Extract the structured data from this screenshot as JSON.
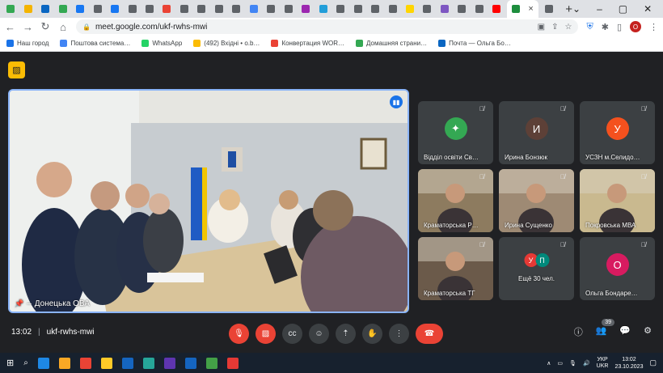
{
  "browser": {
    "tab_close": "×",
    "new_tab": "+",
    "url": "meet.google.com/ukf-rwhs-mwi",
    "profile_initial": "О",
    "bookmarks": [
      {
        "label": "Наш город",
        "color": "#1a73e8"
      },
      {
        "label": "Поштова система…",
        "color": "#4285f4"
      },
      {
        "label": "WhatsApp",
        "color": "#25d366"
      },
      {
        "label": "(492) Вхідні • o.b…",
        "color": "#fbbc04"
      },
      {
        "label": "Конвертация WOR…",
        "color": "#ea4335"
      },
      {
        "label": "Домашняя страни…",
        "color": "#34a853"
      },
      {
        "label": "Почта — Ольга Бо…",
        "color": "#0a66c2"
      }
    ],
    "tab_colors": [
      "#34a853",
      "#f4b400",
      "#0a66c2",
      "#34a853",
      "#1877f2",
      "#5f6368",
      "#1877f2",
      "#5f6368",
      "#5f6368",
      "#ea4335",
      "#5f6368",
      "#5f6368",
      "#5f6368",
      "#5f6368",
      "#4285f4",
      "#5f6368",
      "#5f6368",
      "#9c27b0",
      "#229ed9",
      "#5f6368",
      "#5f6368",
      "#5f6368",
      "#5f6368",
      "#ffd500",
      "#5f6368",
      "#7e57c2",
      "#5f6368",
      "#5f6368",
      "#ff0000",
      "#5f6368"
    ]
  },
  "meet": {
    "main_speaker": "Донецька ОВА",
    "tiles": [
      {
        "name": "Відділ освіти Св…",
        "avatar": "✦",
        "avatar_color": "#34a853",
        "video": false
      },
      {
        "name": "Ирина Бонзюк",
        "avatar": "И",
        "avatar_color": "#5d4037",
        "video": false
      },
      {
        "name": "УСЗН м.Селидо…",
        "avatar": "У",
        "avatar_color": "#f4511e",
        "video": false
      },
      {
        "name": "Краматорська Р…",
        "video": true,
        "bg": "#8d7b5f"
      },
      {
        "name": "Ирина Сущенко",
        "video": true,
        "bg": "#9e8a74"
      },
      {
        "name": "Покровська МВА",
        "video": true,
        "bg": "#c9b98f"
      },
      {
        "name": "Краматорська ТГ",
        "video": true,
        "bg": "#6b5a4a"
      },
      {
        "name": "Ещё 30 чел.",
        "video": false,
        "more": true
      },
      {
        "name": "Ольга Бондаре…",
        "avatar": "О",
        "avatar_color": "#d81b60",
        "video": false
      }
    ],
    "more_avatars": [
      "У",
      "П"
    ],
    "time": "13:02",
    "meeting_code": "ukf-rwhs-mwi",
    "participants_count": "39"
  },
  "taskbar": {
    "lang": "УКР",
    "lang2": "UKR",
    "time": "13:02",
    "date": "23.10.2023",
    "apps": [
      "#1e88e5",
      "#f9a825",
      "#ea4335",
      "#ffca28",
      "#1565c0",
      "#26a69a",
      "#5e35b1",
      "#1565c0",
      "#43a047",
      "#e53935"
    ]
  }
}
